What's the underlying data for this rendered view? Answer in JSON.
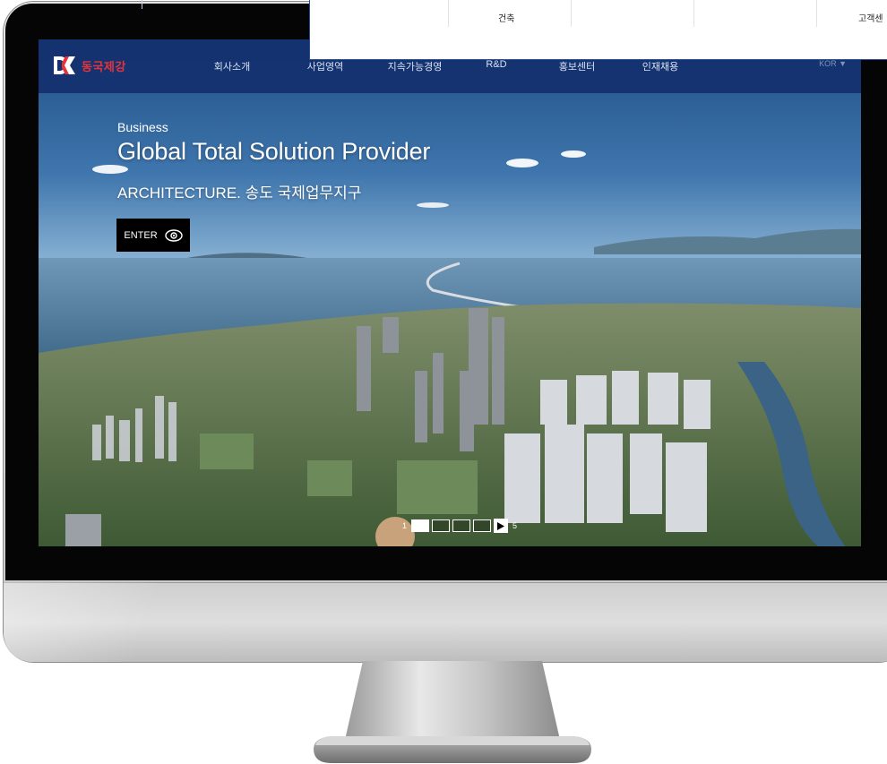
{
  "dropdown": {
    "items": [
      "건축",
      "고객센"
    ]
  },
  "nav": {
    "logo_text": "동국제강",
    "items": [
      "회사소개",
      "사업영역",
      "지속가능경영",
      "R&D",
      "홍보센터",
      "인재채용"
    ],
    "language": "KOR ▼"
  },
  "hero": {
    "eyebrow": "Business",
    "headline": "Global Total Solution Provider",
    "subline": "ARCHITECTURE. 송도 국제업무지구",
    "enter_label": "ENTER"
  },
  "slider": {
    "current": "1",
    "total": "5",
    "active_index": 1,
    "slide_count": 4
  },
  "colors": {
    "nav_bg": "#14306e",
    "brand_red": "#e6333a",
    "sky": "#2a5a86",
    "sea": "#3e6f96",
    "land_green": "#5b7a48",
    "bezel": "#050505",
    "aluminum": "#d4d4d4"
  }
}
